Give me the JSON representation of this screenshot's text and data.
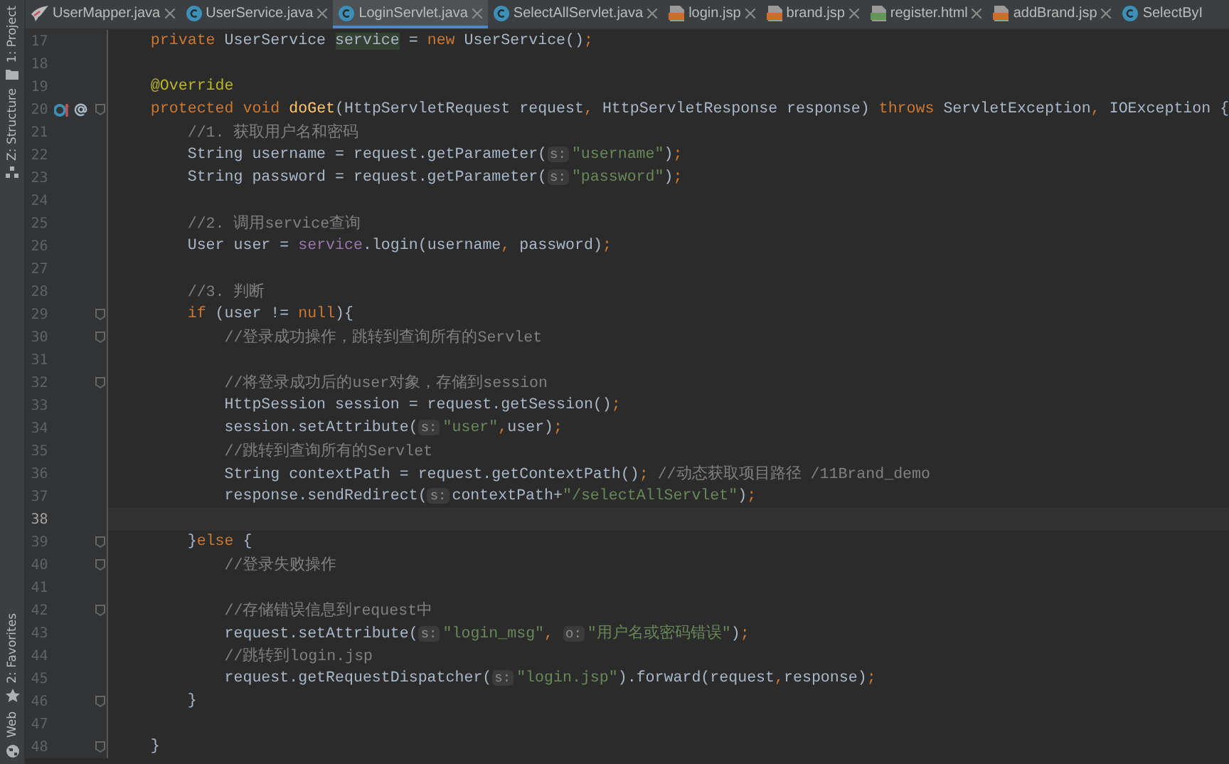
{
  "tool_strip": {
    "top": [
      {
        "label": "1: Project"
      },
      {
        "label": "Z: Structure"
      }
    ],
    "bottom": [
      {
        "label": "2: Favorites"
      },
      {
        "label": "Web"
      }
    ]
  },
  "tabs": [
    {
      "label": "UserMapper.java",
      "kind": "mapper",
      "selected": false,
      "closable": true
    },
    {
      "label": "UserService.java",
      "kind": "class",
      "selected": false,
      "closable": true
    },
    {
      "label": "LoginServlet.java",
      "kind": "class",
      "selected": true,
      "closable": true
    },
    {
      "label": "SelectAllServlet.java",
      "kind": "class",
      "selected": false,
      "closable": true
    },
    {
      "label": "login.jsp",
      "kind": "jsp",
      "selected": false,
      "closable": true
    },
    {
      "label": "brand.jsp",
      "kind": "jsp",
      "selected": false,
      "closable": true
    },
    {
      "label": "register.html",
      "kind": "html",
      "selected": false,
      "closable": true
    },
    {
      "label": "addBrand.jsp",
      "kind": "jsp",
      "selected": false,
      "closable": true
    },
    {
      "label": "SelectByI",
      "kind": "class",
      "selected": false,
      "closable": false
    }
  ],
  "editor": {
    "lines": [
      {
        "number": "17",
        "fold": false,
        "current": false,
        "tokens": [
          {
            "kind": "keyword",
            "text": "    private "
          },
          {
            "kind": "plain",
            "text": "UserService "
          },
          {
            "kind": "match",
            "text": "service"
          },
          {
            "kind": "plain",
            "text": " = "
          },
          {
            "kind": "keyword",
            "text": "new "
          },
          {
            "kind": "plain",
            "text": "UserService()"
          },
          {
            "kind": "keyword",
            "text": ";"
          }
        ]
      },
      {
        "number": "18",
        "fold": false,
        "current": false
      },
      {
        "number": "19",
        "fold": false,
        "current": false,
        "tokens": [
          {
            "kind": "annotation",
            "text": "    @Override"
          }
        ]
      },
      {
        "number": "20",
        "fold": true,
        "current": false,
        "gutter_icons": true,
        "tokens": [
          {
            "kind": "keyword",
            "text": "    protected void "
          },
          {
            "kind": "method",
            "text": "doGet"
          },
          {
            "kind": "plain",
            "text": "(HttpServletRequest request"
          },
          {
            "kind": "keyword",
            "text": ", "
          },
          {
            "kind": "plain",
            "text": "HttpServletResponse response) "
          },
          {
            "kind": "keyword",
            "text": "throws "
          },
          {
            "kind": "plain",
            "text": "ServletException"
          },
          {
            "kind": "keyword",
            "text": ", "
          },
          {
            "kind": "plain",
            "text": "IOException {"
          }
        ]
      },
      {
        "number": "21",
        "fold": false,
        "current": false,
        "tokens": [
          {
            "kind": "comment",
            "text": "        //1. 获取用户名和密码"
          }
        ]
      },
      {
        "number": "22",
        "fold": false,
        "current": false,
        "tokens": [
          {
            "kind": "plain",
            "text": "        String username = request.getParameter("
          },
          {
            "kind": "hint",
            "text": "s:"
          },
          {
            "kind": "string",
            "text": "\"username\""
          },
          {
            "kind": "plain",
            "text": ")"
          },
          {
            "kind": "keyword",
            "text": ";"
          }
        ]
      },
      {
        "number": "23",
        "fold": false,
        "current": false,
        "tokens": [
          {
            "kind": "plain",
            "text": "        String password = request.getParameter("
          },
          {
            "kind": "hint",
            "text": "s:"
          },
          {
            "kind": "string",
            "text": "\"password\""
          },
          {
            "kind": "plain",
            "text": ")"
          },
          {
            "kind": "keyword",
            "text": ";"
          }
        ]
      },
      {
        "number": "24",
        "fold": false,
        "current": false
      },
      {
        "number": "25",
        "fold": false,
        "current": false,
        "tokens": [
          {
            "kind": "comment",
            "text": "        //2. 调用service查询"
          }
        ]
      },
      {
        "number": "26",
        "fold": false,
        "current": false,
        "tokens": [
          {
            "kind": "plain",
            "text": "        User user = "
          },
          {
            "kind": "field",
            "text": "service"
          },
          {
            "kind": "plain",
            "text": ".login(username"
          },
          {
            "kind": "keyword",
            "text": ", "
          },
          {
            "kind": "plain",
            "text": "password)"
          },
          {
            "kind": "keyword",
            "text": ";"
          }
        ]
      },
      {
        "number": "27",
        "fold": false,
        "current": false
      },
      {
        "number": "28",
        "fold": false,
        "current": false,
        "tokens": [
          {
            "kind": "comment",
            "text": "        //3. 判断"
          }
        ]
      },
      {
        "number": "29",
        "fold": true,
        "current": false,
        "tokens": [
          {
            "kind": "keyword",
            "text": "        if "
          },
          {
            "kind": "plain",
            "text": "(user != "
          },
          {
            "kind": "keyword",
            "text": "null"
          },
          {
            "kind": "plain",
            "text": "){"
          }
        ]
      },
      {
        "number": "30",
        "fold": true,
        "current": false,
        "tokens": [
          {
            "kind": "comment",
            "text": "            //登录成功操作，跳转到查询所有的Servlet"
          }
        ]
      },
      {
        "number": "31",
        "fold": false,
        "current": false
      },
      {
        "number": "32",
        "fold": true,
        "current": false,
        "tokens": [
          {
            "kind": "comment",
            "text": "            //将登录成功后的user对象，存储到session"
          }
        ]
      },
      {
        "number": "33",
        "fold": false,
        "current": false,
        "tokens": [
          {
            "kind": "plain",
            "text": "            HttpSession session = request.getSession()"
          },
          {
            "kind": "keyword",
            "text": ";"
          }
        ]
      },
      {
        "number": "34",
        "fold": false,
        "current": false,
        "tokens": [
          {
            "kind": "plain",
            "text": "            session.setAttribute("
          },
          {
            "kind": "hint",
            "text": "s:"
          },
          {
            "kind": "string",
            "text": "\"user\""
          },
          {
            "kind": "keyword",
            "text": ","
          },
          {
            "kind": "plain",
            "text": "user)"
          },
          {
            "kind": "keyword",
            "text": ";"
          }
        ]
      },
      {
        "number": "35",
        "fold": false,
        "current": false,
        "tokens": [
          {
            "kind": "comment",
            "text": "            //跳转到查询所有的Servlet"
          }
        ]
      },
      {
        "number": "36",
        "fold": false,
        "current": false,
        "tokens": [
          {
            "kind": "plain",
            "text": "            String contextPath = request.getContextPath()"
          },
          {
            "kind": "keyword",
            "text": "; "
          },
          {
            "kind": "comment",
            "text": "//动态获取项目路径 /11Brand_demo"
          }
        ]
      },
      {
        "number": "37",
        "fold": false,
        "current": false,
        "tokens": [
          {
            "kind": "plain",
            "text": "            response.sendRedirect("
          },
          {
            "kind": "hint",
            "text": "s:"
          },
          {
            "kind": "plain",
            "text": "contextPath+"
          },
          {
            "kind": "string",
            "text": "\"/selectAllServlet\""
          },
          {
            "kind": "plain",
            "text": ")"
          },
          {
            "kind": "keyword",
            "text": ";"
          }
        ]
      },
      {
        "number": "38",
        "fold": false,
        "current": true
      },
      {
        "number": "39",
        "fold": true,
        "current": false,
        "tokens": [
          {
            "kind": "plain",
            "text": "        }"
          },
          {
            "kind": "keyword",
            "text": "else "
          },
          {
            "kind": "plain",
            "text": "{"
          }
        ]
      },
      {
        "number": "40",
        "fold": true,
        "current": false,
        "tokens": [
          {
            "kind": "comment",
            "text": "            //登录失败操作"
          }
        ]
      },
      {
        "number": "41",
        "fold": false,
        "current": false
      },
      {
        "number": "42",
        "fold": true,
        "current": false,
        "tokens": [
          {
            "kind": "comment",
            "text": "            //存储错误信息到request中"
          }
        ]
      },
      {
        "number": "43",
        "fold": false,
        "current": false,
        "tokens": [
          {
            "kind": "plain",
            "text": "            request.setAttribute("
          },
          {
            "kind": "hint",
            "text": "s:"
          },
          {
            "kind": "string",
            "text": "\"login_msg\""
          },
          {
            "kind": "keyword",
            "text": ", "
          },
          {
            "kind": "hint",
            "text": "o:"
          },
          {
            "kind": "string",
            "text": "\"用户名或密码错误\""
          },
          {
            "kind": "plain",
            "text": ")"
          },
          {
            "kind": "keyword",
            "text": ";"
          }
        ]
      },
      {
        "number": "44",
        "fold": false,
        "current": false,
        "tokens": [
          {
            "kind": "comment",
            "text": "            //跳转到login.jsp"
          }
        ]
      },
      {
        "number": "45",
        "fold": false,
        "current": false,
        "tokens": [
          {
            "kind": "plain",
            "text": "            request.getRequestDispatcher("
          },
          {
            "kind": "hint",
            "text": "s:"
          },
          {
            "kind": "string",
            "text": "\"login.jsp\""
          },
          {
            "kind": "plain",
            "text": ").forward(request"
          },
          {
            "kind": "keyword",
            "text": ","
          },
          {
            "kind": "plain",
            "text": "response)"
          },
          {
            "kind": "keyword",
            "text": ";"
          }
        ]
      },
      {
        "number": "46",
        "fold": true,
        "current": false,
        "tokens": [
          {
            "kind": "plain",
            "text": "        }"
          }
        ]
      },
      {
        "number": "47",
        "fold": false,
        "current": false
      },
      {
        "number": "48",
        "fold": true,
        "current": false,
        "tokens": [
          {
            "kind": "plain",
            "text": "    }"
          }
        ]
      }
    ]
  }
}
